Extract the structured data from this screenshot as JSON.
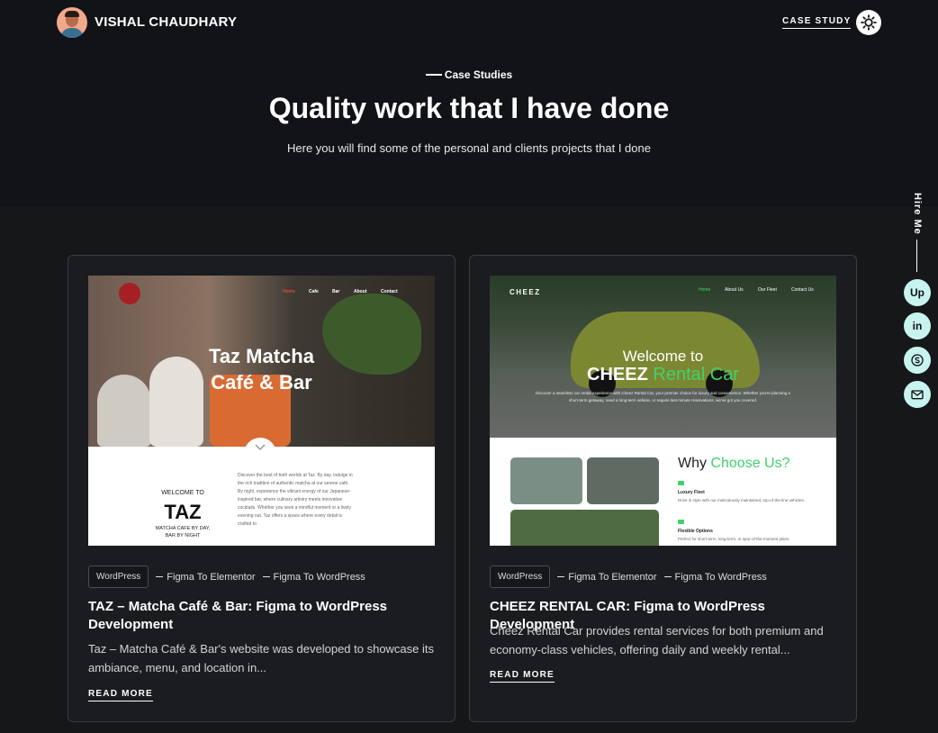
{
  "header": {
    "site_name": "VISHAL CHAUDHARY",
    "nav_link": "CASE STUDY"
  },
  "hero": {
    "eyebrow": "Case Studies",
    "title": "Quality work that I have done",
    "subtitle": "Here you will find some of the personal and clients projects that I done"
  },
  "sidebar": {
    "hire_label": "Hire Me",
    "socials": [
      {
        "icon": "upwork-icon",
        "label": "Up"
      },
      {
        "icon": "linkedin-icon",
        "label": "in"
      },
      {
        "icon": "skype-icon",
        "label": "S"
      },
      {
        "icon": "mail-icon",
        "label": ""
      }
    ]
  },
  "colors": {
    "accent": "#c8f4ef",
    "background": "#161719",
    "hero_background": "#111317",
    "brand_green": "#3fd26b"
  },
  "cards": [
    {
      "tag_primary": "WordPress",
      "tag_2": "Figma To Elementor",
      "tag_3": "Figma To WordPress",
      "title": "TAZ – Matcha Café & Bar: Figma to WordPress Development",
      "description": "Taz – Matcha Café & Bar's website was developed to showcase its ambiance, menu, and location in...",
      "read_more": "READ MORE",
      "thumb": {
        "nav": [
          "Home",
          "Cafe",
          "Bar",
          "About",
          "Contact"
        ],
        "headline_1": "Taz Matcha",
        "headline_2": "Café & Bar",
        "welcome": "WELCOME TO",
        "big": "TAZ",
        "small_1": "MATCHA CAFE BY DAY,",
        "small_2": "BAR BY NIGHT",
        "para": "Discover the best of both worlds at Taz. By day, indulge in the rich tradition of authentic matcha at our serene café. By night, experience the vibrant energy of our Japanese-inspired bar, where culinary artistry meets innovative cocktails. Whether you seek a mindful moment or a lively evening out, Taz offers a space where every detail is crafted to"
      }
    },
    {
      "tag_primary": "WordPress",
      "tag_2": "Figma To Elementor",
      "tag_3": "Figma To WordPress",
      "title": "CHEEZ RENTAL CAR: Figma to WordPress Development",
      "description": "Cheez Rental Car provides rental services for both premium and economy-class vehicles, offering daily and weekly rental...",
      "read_more": "READ MORE",
      "thumb": {
        "logo": "CHEEZ",
        "nav": [
          "Home",
          "About Us",
          "Our Fleet",
          "Contact Us"
        ],
        "welcome": "Welcome to",
        "brand_white": "CHEEZ",
        "brand_green": "Rental Car",
        "tagline": "Discover a seamless car rental experience with Cheez Rental Car, your premier choice for luxury and convenience. Whether you're planning a short-term getaway, need a long-term vehicle, or require last-minute reservations, we've got you covered.",
        "why": "Why",
        "why_green": "Choose Us?",
        "feature_1": "Luxury Fleet",
        "feature_1_desc": "Drive in style with our meticulously maintained, top-of-the-line vehicles.",
        "feature_2": "Flexible Options",
        "feature_2_desc": "Perfect for short-term, long-term, or spur-of-the-moment plans."
      }
    }
  ]
}
